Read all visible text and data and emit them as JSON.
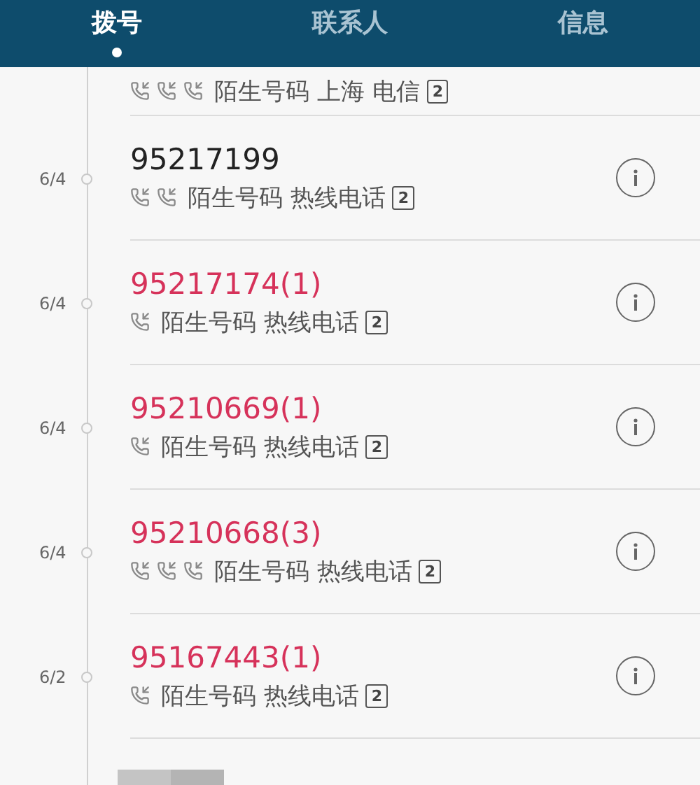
{
  "tabs": [
    {
      "label": "拨号",
      "selected": true
    },
    {
      "label": "联系人",
      "selected": false
    },
    {
      "label": "信息",
      "selected": false
    }
  ],
  "calls": [
    {
      "call_icons": [
        {
          "kind": "incoming"
        },
        {
          "kind": "incoming"
        },
        {
          "kind": "incoming"
        }
      ],
      "description": "陌生号码 上海 电信",
      "sim": "2"
    },
    {
      "date": "6/4",
      "number": "95217199",
      "missed": false,
      "call_icons": [
        {
          "kind": "incoming"
        },
        {
          "kind": "incoming"
        }
      ],
      "description": "陌生号码 热线电话",
      "sim": "2"
    },
    {
      "date": "6/4",
      "number": "95217174(1)",
      "missed": true,
      "call_icons": [
        {
          "kind": "incoming"
        }
      ],
      "description": "陌生号码 热线电话",
      "sim": "2"
    },
    {
      "date": "6/4",
      "number": "95210669(1)",
      "missed": true,
      "call_icons": [
        {
          "kind": "incoming"
        }
      ],
      "description": "陌生号码 热线电话",
      "sim": "2"
    },
    {
      "date": "6/4",
      "number": "95210668(3)",
      "missed": true,
      "call_icons": [
        {
          "kind": "incoming"
        },
        {
          "kind": "incoming"
        },
        {
          "kind": "incoming"
        }
      ],
      "description": "陌生号码 热线电话",
      "sim": "2"
    },
    {
      "date": "6/2",
      "number": "95167443(1)",
      "missed": true,
      "call_icons": [
        {
          "kind": "incoming"
        }
      ],
      "description": "陌生号码 热线电话",
      "sim": "2"
    }
  ]
}
